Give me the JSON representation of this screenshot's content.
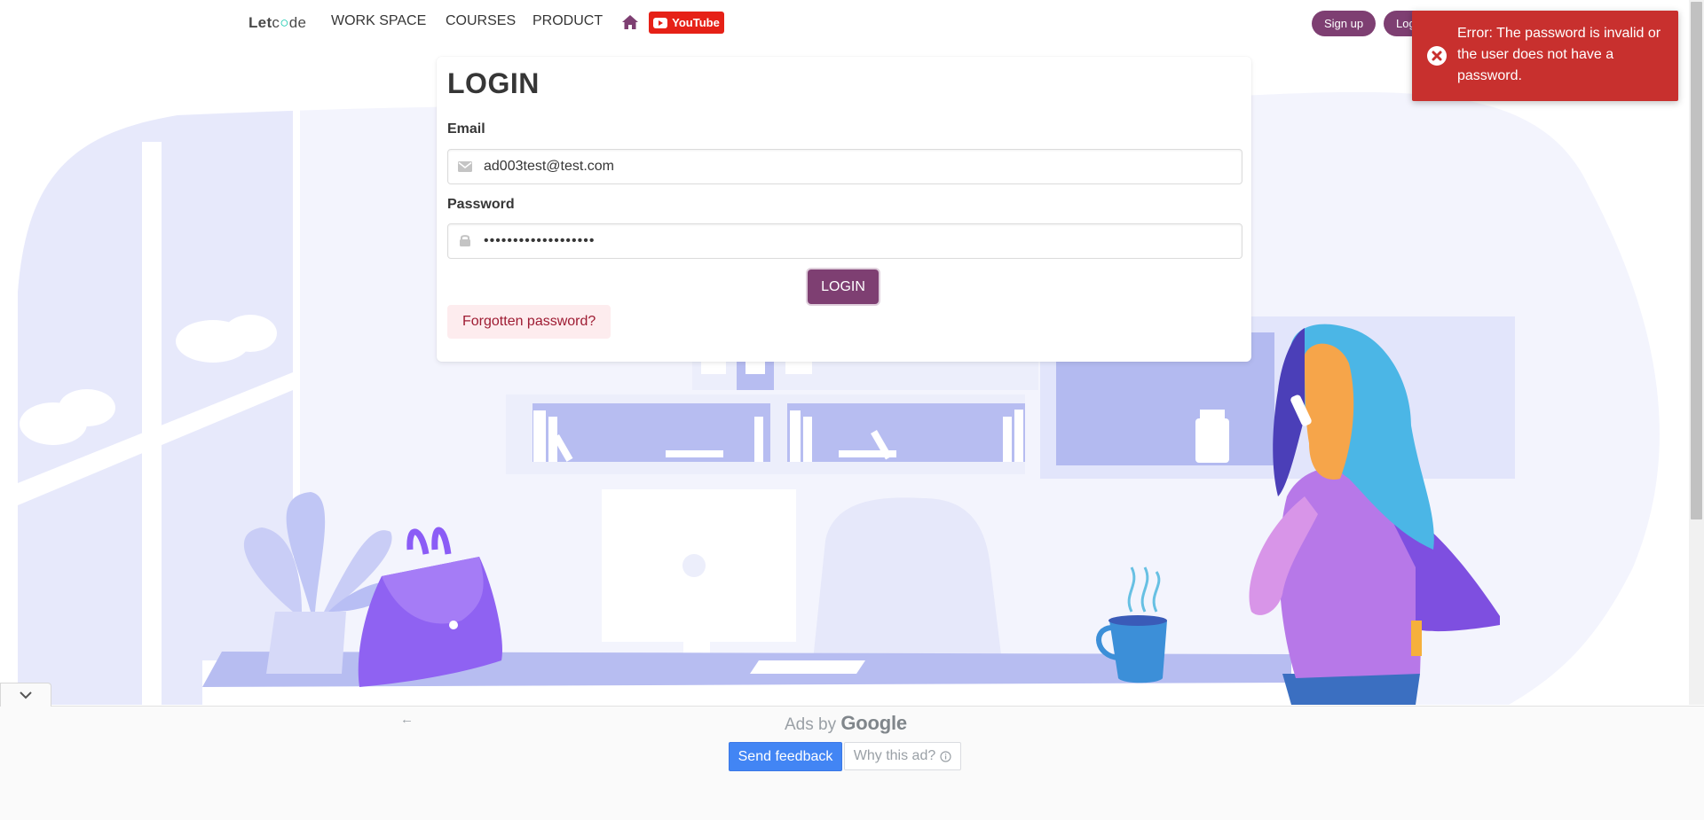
{
  "navbar": {
    "brand": {
      "part1": "Let",
      "part2": "c",
      "part3": "de"
    },
    "items": [
      {
        "label": "WORK SPACE"
      },
      {
        "label": "COURSES"
      },
      {
        "label": "PRODUCT"
      }
    ],
    "home_icon": "home-icon",
    "youtube_label": "YouTube",
    "signup_label": "Sign up",
    "login_label": "Log"
  },
  "login": {
    "title": "LOGIN",
    "email_label": "Email",
    "email_value": "ad003test@test.com",
    "password_label": "Password",
    "password_value": "•••••••••••••••••••",
    "submit_label": "LOGIN",
    "forgot_label": "Forgotten password?"
  },
  "toast": {
    "icon": "error-icon",
    "message": "Error: The password is invalid or the user does not have a password."
  },
  "ad": {
    "ads_by": "Ads by",
    "google": "Google",
    "send_feedback": "Send feedback",
    "why_this_ad": "Why this ad?",
    "back_icon": "←"
  },
  "colors": {
    "brand_purple": "#7e3f72",
    "error_red": "#c8302e",
    "youtube_red": "#e62117",
    "feedback_blue": "#4285f4",
    "illustration_lavender": "#b3baf0"
  }
}
